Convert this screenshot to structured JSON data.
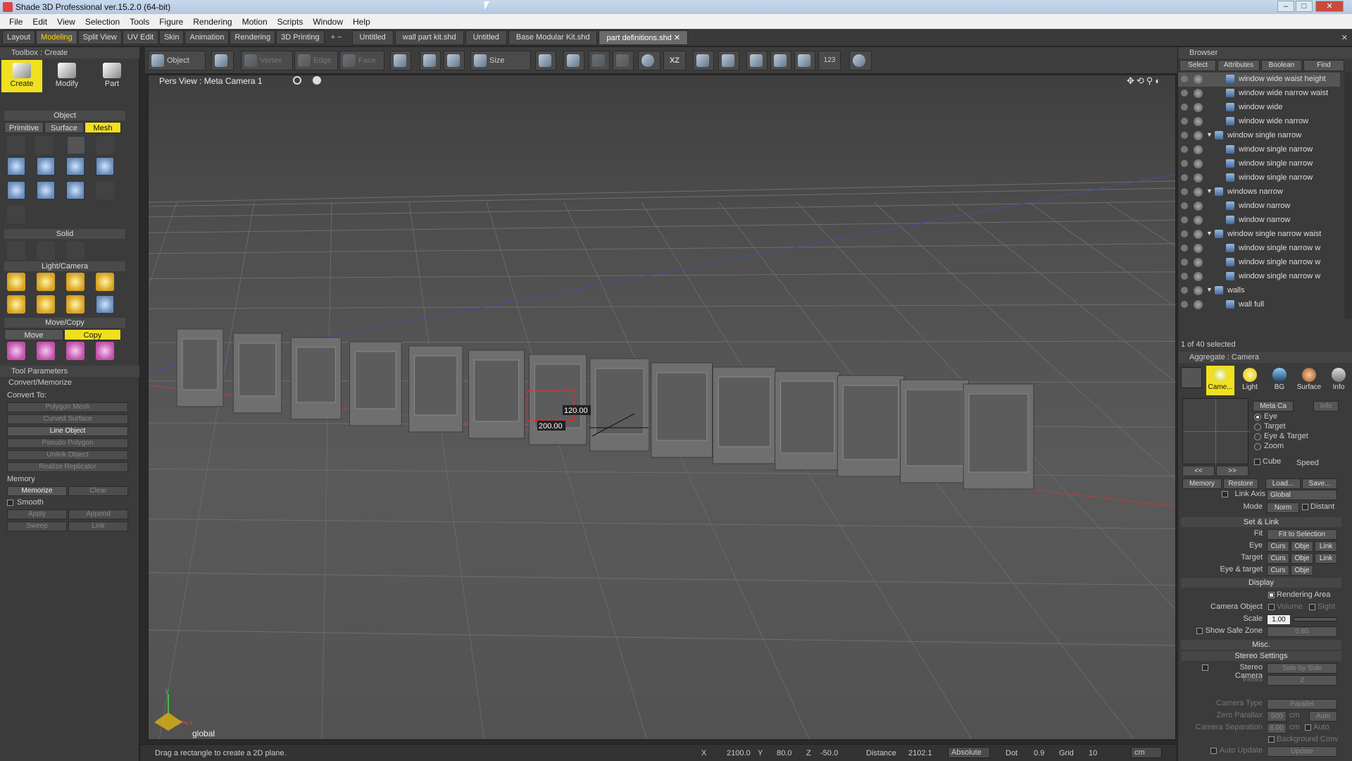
{
  "window": {
    "title": "Shade 3D Professional ver.15.2.0 (64-bit)"
  },
  "menu": [
    "File",
    "Edit",
    "View",
    "Selection",
    "Tools",
    "Figure",
    "Rendering",
    "Motion",
    "Scripts",
    "Window",
    "Help"
  ],
  "mode_tabs": [
    "Layout",
    "Modeling",
    "Split View",
    "UV Edit",
    "Skin",
    "Animation",
    "Rendering",
    "3D Printing"
  ],
  "mode_tabs_add": "+ −",
  "doc_tabs": [
    "Untitled",
    "wall part kit.shd",
    "Untitled",
    "Base Modular Kit.shd",
    "part definitions.shd"
  ],
  "toolbox": {
    "header": "Toolbox : Create",
    "big_buttons": [
      "Create",
      "Modify",
      "Part"
    ],
    "object_section": "Object",
    "sub_tabs": [
      "Primitive",
      "Surface",
      "Mesh"
    ],
    "solid_section": "Solid",
    "lightcam_section": "Light/Camera",
    "movecopy_section": "Move/Copy",
    "move_tabs": [
      "Move",
      "Copy"
    ]
  },
  "tool_params": {
    "header": "Tool Parameters",
    "convert_header": "Convert/Memorize",
    "convert_to": "Convert To:",
    "buttons": [
      "Polygon Mesh",
      "Curved Surface",
      "Line Object",
      "Pseudo Polygon",
      "Unlink Object",
      "Realize Replicator"
    ],
    "memory": "Memory",
    "memorize": "Memorize",
    "clear": "Clear",
    "smooth": "Smooth",
    "apply": "Apply",
    "append": "Append",
    "sweep": "Sweep",
    "link": "Link"
  },
  "toolbar": {
    "object": "Object",
    "vertex": "Vertex",
    "edge": "Edge",
    "face": "Face",
    "size": "Size",
    "xz": "XZ",
    "num": "123"
  },
  "viewport": {
    "title": "Pers View : Meta Camera 1",
    "dim_w": "120.00",
    "dim_h": "200.00",
    "axis_label": "global",
    "axis_y": "y",
    "axis_x": "x"
  },
  "status": {
    "hint": "Drag a rectangle to create a 2D plane.",
    "x_label": "X",
    "x": "2100.0",
    "y_label": "Y",
    "y": "80.0",
    "z_label": "Z",
    "z": "-50.0",
    "distance_label": "Distance",
    "distance": "2102.1",
    "mode": "Absolute",
    "dot_label": "Dot",
    "dot": "0.9",
    "grid_label": "Grid",
    "grid": "10",
    "unit": "cm"
  },
  "browser": {
    "header": "Browser",
    "tabs": [
      "Select",
      "Attributes",
      "Boolean",
      "Find"
    ],
    "items": [
      {
        "name": "window wide waist height",
        "indent": 2,
        "selected": true,
        "group": false
      },
      {
        "name": "window wide narrow waist",
        "indent": 2,
        "selected": false,
        "group": false
      },
      {
        "name": "window wide",
        "indent": 2,
        "selected": false,
        "group": false
      },
      {
        "name": "window wide narrow",
        "indent": 2,
        "selected": false,
        "group": false
      },
      {
        "name": "window single narrow",
        "indent": 1,
        "selected": false,
        "group": true
      },
      {
        "name": "window single narrow",
        "indent": 2,
        "selected": false,
        "group": false
      },
      {
        "name": "window single narrow",
        "indent": 2,
        "selected": false,
        "group": false
      },
      {
        "name": "window single narrow",
        "indent": 2,
        "selected": false,
        "group": false
      },
      {
        "name": "windows narrow",
        "indent": 1,
        "selected": false,
        "group": true
      },
      {
        "name": "window narrow",
        "indent": 2,
        "selected": false,
        "group": false
      },
      {
        "name": "window narrow",
        "indent": 2,
        "selected": false,
        "group": false
      },
      {
        "name": "window single narrow waist",
        "indent": 1,
        "selected": false,
        "group": true
      },
      {
        "name": "window single narrow w",
        "indent": 2,
        "selected": false,
        "group": false
      },
      {
        "name": "window single narrow w",
        "indent": 2,
        "selected": false,
        "group": false
      },
      {
        "name": "window single narrow w",
        "indent": 2,
        "selected": false,
        "group": false
      },
      {
        "name": "walls",
        "indent": 1,
        "selected": false,
        "group": true
      },
      {
        "name": "wall full",
        "indent": 2,
        "selected": false,
        "group": false
      }
    ],
    "selection_count": "1 of 40 selected"
  },
  "aggregate": {
    "header": "Aggregate : Camera",
    "icons": [
      "Came...",
      "Light",
      "BG",
      "Surface",
      "Info"
    ],
    "meta_camera": "Meta Ca",
    "info_btn": "Info",
    "radios": [
      "Eye",
      "Target",
      "Eye & Target",
      "Zoom"
    ],
    "cube": "Cube",
    "speed": "Speed",
    "nav_prev": "<<",
    "nav_next": ">>",
    "memory": "Memory",
    "restore": "Restore",
    "load": "Load...",
    "save": "Save...",
    "link_axis": "Link Axis",
    "link_axis_val": "Global",
    "mode": "Mode",
    "mode_val": "Norm",
    "distant": "Distant",
    "set_link": "Set & Link",
    "fit": "Fit",
    "fit_btn": "Fit to Selection",
    "eye": "Eye",
    "target": "Target",
    "eye_target": "Eye & target",
    "curs": "Curs",
    "obje": "Obje",
    "link": "Link",
    "display": "Display",
    "rendering_area": "Rendering Area",
    "camera_object": "Camera Object",
    "volume": "Volume",
    "sight": "Sight",
    "scale": "Scale",
    "scale_val": "1.00",
    "show_safe_zone": "Show Safe Zone",
    "safe_zone_val": "0.80",
    "misc": "Misc.",
    "stereo_settings": "Stereo Settings",
    "stereo_camera": "Stereo Camera",
    "side_by_side": "Side by Side",
    "views": "Views",
    "views_val": "2",
    "camera_type": "Camera Type",
    "camera_type_val": "Parallel",
    "zero_parallax": "Zero Parallax",
    "zero_parallax_val": "500",
    "cm": "cm",
    "auto": "Auto",
    "camera_separation": "Camera Separation",
    "camera_separation_val": "6.00",
    "background_conv": "Background Conv",
    "auto_update": "Auto Update",
    "update": "Update"
  },
  "colors": {
    "accent": "#f0e020",
    "active_tab_text": "#ffd700",
    "selection": "#ff2020"
  }
}
